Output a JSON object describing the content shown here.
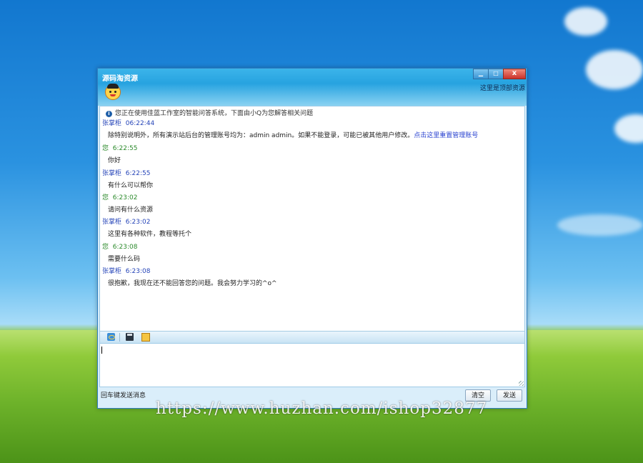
{
  "window": {
    "title": "源码淘资源",
    "top_link": "这里是顶部资源",
    "controls": {
      "minimize": "▁",
      "maximize": "□",
      "close": "x"
    }
  },
  "chat": {
    "notice": "您正在使用佳蓝工作室的智能问答系统，下面由小Q为您解答相关问题",
    "messages": [
      {
        "sender": "张掌柜",
        "time": "06:22:44",
        "role": "agent",
        "text": "除特别说明外，所有演示站后台的管理账号均为：admin admin。如果不能登录，可能已被其他用户修改。",
        "link": "点击这里重置管理账号"
      },
      {
        "sender": "您",
        "time": "6:22:55",
        "role": "user",
        "text": "你好"
      },
      {
        "sender": "张掌柜",
        "time": "6:22:55",
        "role": "agent",
        "text": "有什么可以帮你"
      },
      {
        "sender": "您",
        "time": "6:23:02",
        "role": "user",
        "text": "请问有什么资源"
      },
      {
        "sender": "张掌柜",
        "time": "6:23:02",
        "role": "agent",
        "text": "这里有各种软件，教程等托个"
      },
      {
        "sender": "您",
        "time": "6:23:08",
        "role": "user",
        "text": "需要什么码"
      },
      {
        "sender": "张掌柜",
        "time": "6:23:08",
        "role": "agent",
        "text": "很抱歉，我现在还不能回答您的问题。我会努力学习的^o^"
      }
    ]
  },
  "toolbar": {
    "icons": [
      "ie-icon",
      "save-icon",
      "note-icon"
    ]
  },
  "input": {
    "value": ""
  },
  "status": {
    "hint": "回车键发送消息"
  },
  "buttons": {
    "clear": "清空",
    "send": "发送"
  },
  "watermark": "https://www.huzhan.com/ishop32877"
}
